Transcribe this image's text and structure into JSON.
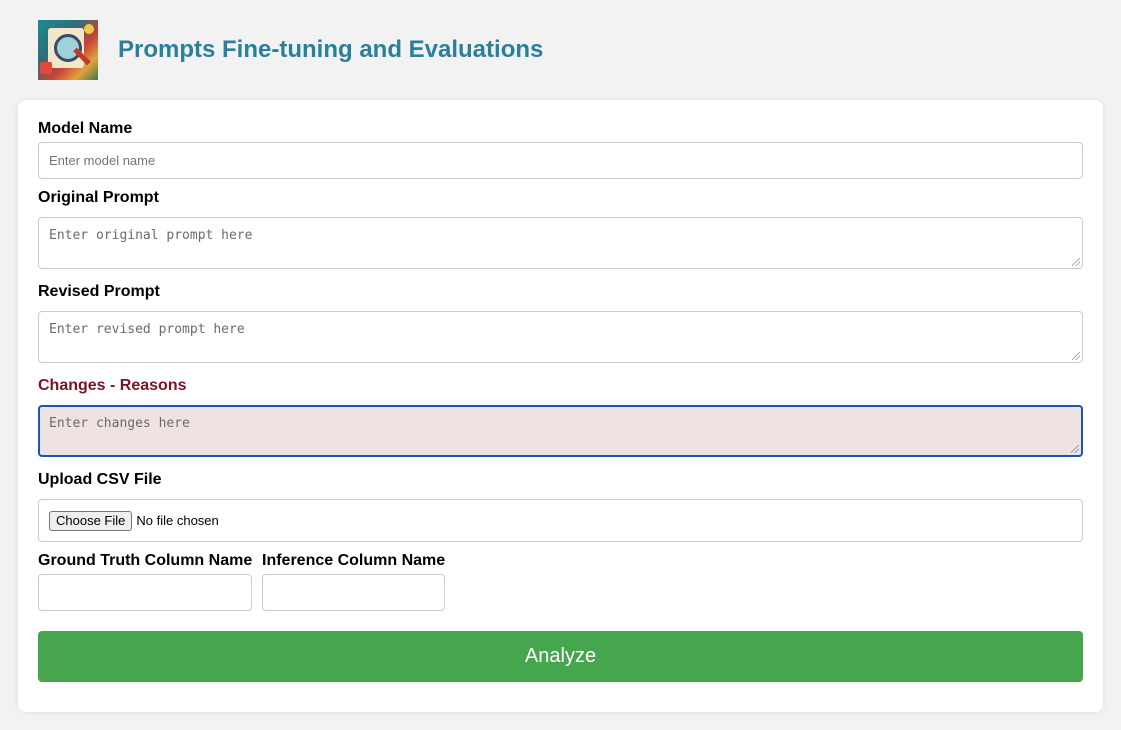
{
  "header": {
    "logo_icon": "prompt-evaluation-logo-icon",
    "title": "Prompts Fine-tuning and Evaluations",
    "title_color": "#2b7f9c"
  },
  "form": {
    "model_name": {
      "label": "Model Name",
      "placeholder": "Enter model name",
      "value": ""
    },
    "original_prompt": {
      "label": "Original Prompt",
      "placeholder": "Enter original prompt here",
      "value": ""
    },
    "revised_prompt": {
      "label": "Revised Prompt",
      "placeholder": "Enter revised prompt here",
      "value": ""
    },
    "changes": {
      "label": "Changes - Reasons",
      "placeholder": "Enter changes here",
      "value": "",
      "label_color": "#7a1424",
      "background": "#eee2e2",
      "focus_border": "#1a56b8"
    },
    "csv_upload": {
      "label": "Upload CSV File",
      "button_label": "Choose File",
      "status": "No file chosen"
    },
    "ground_truth_column": {
      "label": "Ground Truth Column Name",
      "value": ""
    },
    "inference_column": {
      "label": "Inference Column Name",
      "value": ""
    },
    "analyze_button": {
      "label": "Analyze",
      "color": "#46a64e"
    }
  }
}
